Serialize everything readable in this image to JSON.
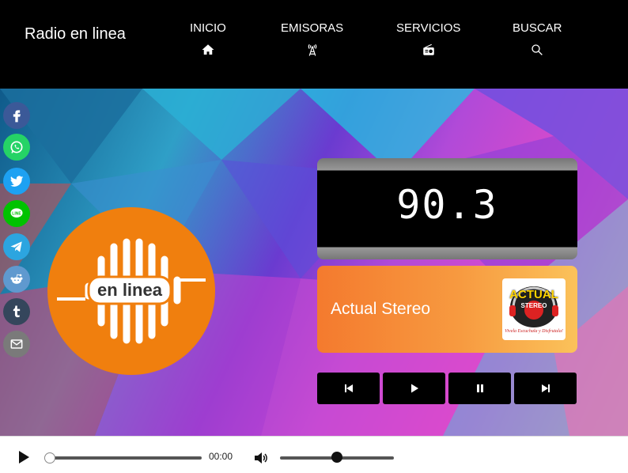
{
  "header": {
    "brand": "Radio en linea",
    "nav": [
      {
        "label": "INICIO",
        "icon": "home-icon"
      },
      {
        "label": "EMISORAS",
        "icon": "antenna-icon"
      },
      {
        "label": "SERVICIOS",
        "icon": "radio-icon"
      },
      {
        "label": "BUSCAR",
        "icon": "search-icon"
      }
    ]
  },
  "social": [
    {
      "name": "facebook",
      "color": "#3b5998"
    },
    {
      "name": "whatsapp",
      "color": "#25d366"
    },
    {
      "name": "twitter",
      "color": "#1da1f2"
    },
    {
      "name": "line",
      "color": "#00c300"
    },
    {
      "name": "telegram",
      "color": "#2ca5e0"
    },
    {
      "name": "reddit",
      "color": "#5f99cf"
    },
    {
      "name": "tumblr",
      "color": "#35465c"
    },
    {
      "name": "email",
      "color": "#7a7a7a"
    }
  ],
  "logo": {
    "text": "en linea",
    "color": "#f07f0e"
  },
  "player": {
    "frequency": "90.3",
    "station_name": "Actual Stereo",
    "station_logo_text": "ACTUAL",
    "station_logo_sub": "STEREO",
    "station_logo_tagline": "Vivela Escuchala y Disfrutala!",
    "controls": [
      "previous",
      "play",
      "pause",
      "next"
    ]
  },
  "audio": {
    "current_time": "00:00",
    "progress": 0,
    "volume": 0.5
  }
}
